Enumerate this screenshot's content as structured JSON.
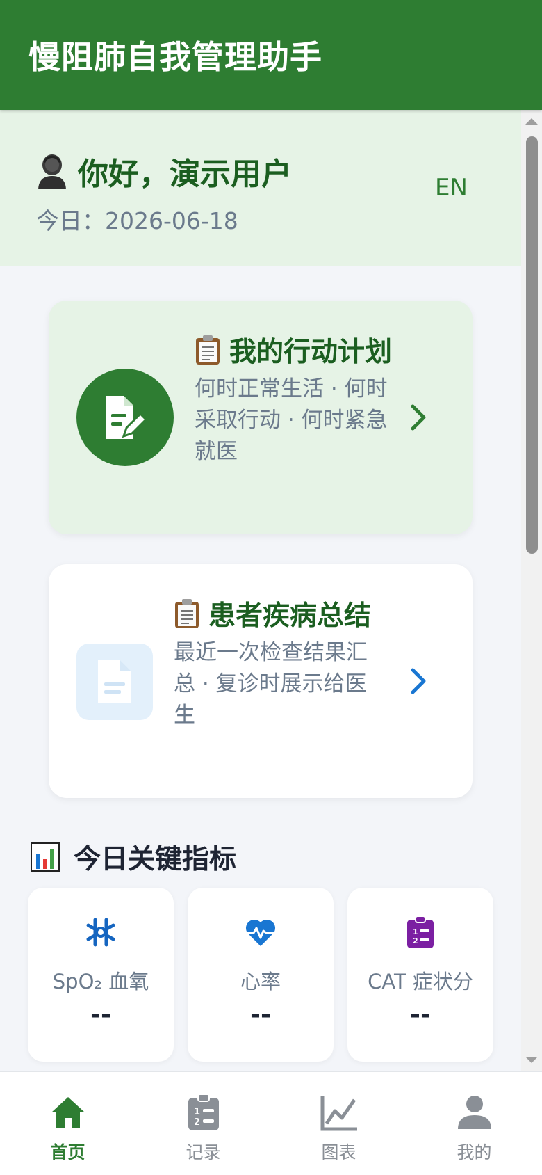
{
  "app": {
    "title": "慢阻肺自我管理助手"
  },
  "greeting": {
    "text": "你好，演示用户",
    "date": "今日：2026-06-18",
    "lang_toggle": "EN"
  },
  "cards": [
    {
      "id": "action-plan",
      "emoji_icon": "clipboard-icon",
      "title": "我的行动计划",
      "subtitle": "何时正常生活 · 何时采取行动 · 何时紧急就医",
      "icon": "document-edit-icon",
      "colors": {
        "bg": "#e6f3e6",
        "icon_bg": "#2e7d32",
        "chevron": "#2e7d32"
      }
    },
    {
      "id": "disease-summary",
      "emoji_icon": "clipboard-icon",
      "title": "患者疾病总结",
      "subtitle": "最近一次检查结果汇总 · 复诊时展示给医生",
      "icon": "document-icon",
      "colors": {
        "bg": "#ffffff",
        "icon_bg": "#e3f0fb",
        "chevron": "#1976d2"
      }
    }
  ],
  "metrics_section": {
    "title": "今日关键指标",
    "icon": "bar-chart-icon",
    "items": [
      {
        "label": "SpO₂ 血氧",
        "value": "--",
        "icon": "molecule-icon",
        "color": "#1565c0"
      },
      {
        "label": "心率",
        "value": "--",
        "icon": "heart-pulse-icon",
        "color": "#1976d2"
      },
      {
        "label": "CAT 症状分",
        "value": "--",
        "icon": "clipboard-list-icon",
        "color": "#7b1fa2"
      }
    ]
  },
  "bottom_nav": [
    {
      "label": "首页",
      "icon": "home-icon",
      "active": true
    },
    {
      "label": "记录",
      "icon": "clipboard-list-icon",
      "active": false
    },
    {
      "label": "图表",
      "icon": "line-chart-icon",
      "active": false
    },
    {
      "label": "我的",
      "icon": "user-icon",
      "active": false
    }
  ],
  "colors": {
    "primary": "#2e7d32",
    "primary_dark": "#1b5e20",
    "background": "#f3f5f9",
    "muted_text": "#6b7a8c"
  }
}
